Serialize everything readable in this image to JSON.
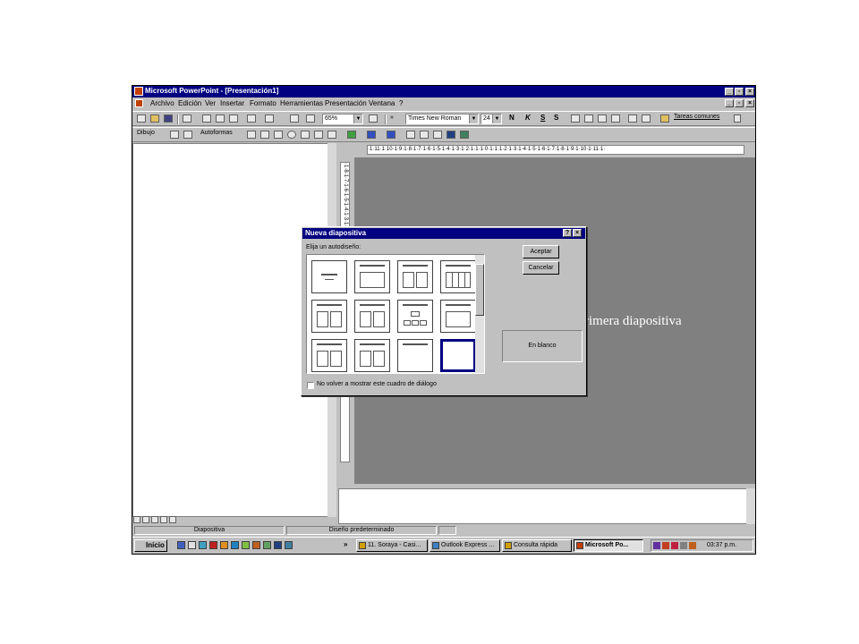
{
  "window": {
    "title": "Microsoft PowerPoint - [Presentación1]"
  },
  "menu": [
    "Archivo",
    "Edición",
    "Ver",
    "Insertar",
    "Formato",
    "Herramientas",
    "Presentación",
    "Ventana",
    "?"
  ],
  "toolbar": {
    "zoom": "65%",
    "font": "Times New Roman",
    "size": "24",
    "tareas": "Tareas comunes",
    "bold": "N",
    "italic": "K",
    "underline": "S",
    "shadow": "S"
  },
  "drawing": {
    "dibujo": "Dibujo",
    "autoformas": "Autoformas"
  },
  "ruler": {
    "h": "·1·11·1·10·1·9·1·8·1·7·1·6·1·5·1·4·1·3·1·2·1·1·1·0·1·1·1·2·1·3·1·4·1·5·1·6·1·7·1·8·1·9·1·10·1·11·1·",
    "v": "·1·8·1·7·1·6·1·5·1·4·1·3·1·2·1·1·1·0·1·1·1·2·1·3·1·4·1·5·1·6·1·7·1·8·1·"
  },
  "slide": {
    "text": "rimera diapositiva"
  },
  "dialog": {
    "title": "Nueva diapositiva",
    "label": "Elija un autodiseño:",
    "accept": "Aceptar",
    "cancel": "Cancelar",
    "preview": "En blanco",
    "checkbox": "No volver a mostrar este cuadro de diálogo"
  },
  "status": {
    "slide": "Diapositiva",
    "design": "Diseño predeterminado"
  },
  "taskbar": {
    "start": "Inicio",
    "tasks": [
      "11. Soraya - Casi...",
      "Outlook Express ...",
      "Consulta rápida",
      "Microsoft Po..."
    ],
    "clock": "03:37 p.m."
  },
  "colors": {
    "titlebar": "#000080",
    "face": "#c0c0c0",
    "canvas": "#808080"
  }
}
